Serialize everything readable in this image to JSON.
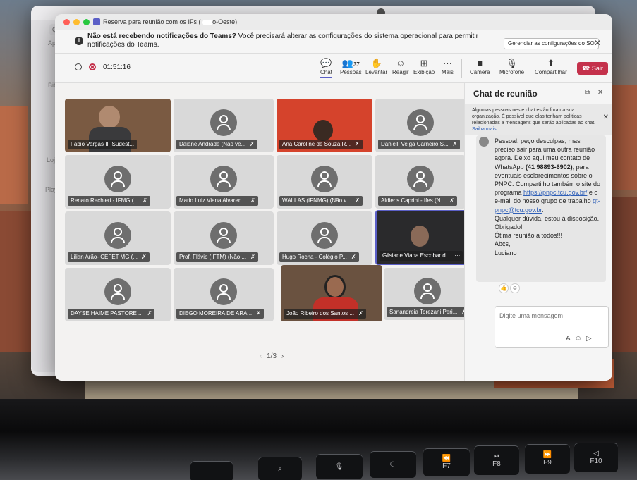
{
  "window": {
    "title": "Reserva para reunião com os IFs (",
    "title_tail": "o-Oeste)"
  },
  "back_app": {
    "search_label": "Q Bi",
    "labels": [
      "Apple",
      "Bibliot",
      "Loja",
      "Playli"
    ]
  },
  "notification": {
    "bold": "Não está recebendo notificações do Teams?",
    "text": " Você precisará alterar as configurações do sistema operacional para permitir notificações do Teams.",
    "button": "Gerenciar as configurações do SO",
    "close": "✕"
  },
  "toolbar": {
    "timer": "01:51:16",
    "people_count": "37",
    "items": [
      {
        "label": "Chat",
        "glyph": "💬"
      },
      {
        "label": "Pessoas",
        "glyph": "👥"
      },
      {
        "label": "Levantar",
        "glyph": "✋"
      },
      {
        "label": "Reagir",
        "glyph": "☺"
      },
      {
        "label": "Exibição",
        "glyph": "⊞"
      },
      {
        "label": "Mais",
        "glyph": "···"
      },
      {
        "label": "Câmera",
        "glyph": "■"
      },
      {
        "label": "Microfone",
        "glyph": "🎙"
      },
      {
        "label": "Compartilhar",
        "glyph": "⬆"
      }
    ],
    "leave": "☎ Sair"
  },
  "participants": [
    {
      "name": "Fabio Vargas IF Sudest...",
      "video": true
    },
    {
      "name": "Daiane Andrade (Não ve...",
      "video": false
    },
    {
      "name": "Ana Caroline de Souza R...",
      "video": true
    },
    {
      "name": "Danielli Veiga Carneiro S...",
      "video": false
    },
    {
      "name": "Renato Rechieri - IFMG (...",
      "video": false
    },
    {
      "name": "Mario Luiz Viana Alvaren...",
      "video": false
    },
    {
      "name": "WALLAS (IFNMG) (Não v...",
      "video": false
    },
    {
      "name": "Aldieris Caprini - Ifes (N...",
      "video": false
    },
    {
      "name": "Lilian Arão- CEFET MG (...",
      "video": false
    },
    {
      "name": "Prof. Flávio (IFTM) (Não ...",
      "video": false
    },
    {
      "name": "Hugo Rocha - Colégio P...",
      "video": false
    },
    {
      "name": "Gilsiane Viana Escobar d...",
      "video": true
    },
    {
      "name": "DAYSE HAIME PASTORE ...",
      "video": false
    },
    {
      "name": "DIEGO MOREIRA DE ARA...",
      "video": false
    },
    {
      "name": "João Ribeiro dos Santos ...",
      "video": true
    },
    {
      "name": "Sanandreia Torezani Peri...",
      "video": false
    }
  ],
  "pagination": {
    "text": "1/3"
  },
  "chat": {
    "title": "Chat de reunião",
    "warning": "Algumas pessoas neste chat estão fora da sua organização. É possível que elas tenham políticas relacionadas a mensagens que serão aplicadas ao chat.",
    "warning_link": "Saiba mais",
    "message": {
      "l1": "Pessoal, peço desculpas, mas preciso sair para uma outra reunião agora. Deixo aqui meu contato de WhatsApp ",
      "phone": "(41 98893-6902)",
      "l2": ", para eventuais esclarecimentos sobre o PNPC. Compartilho também o site do programa ",
      "site": "https://pnpc.tcu.gov.br/",
      "l3": " e o e-mail do nosso grupo de trabalho ",
      "email": "gt-pnpc@tcu.gov.br",
      "l4": ".",
      "l5": "Qualquer dúvida, estou à disposição.",
      "l6": "Obrigado!",
      "l7": "Ótima reunião a todos!!!",
      "l8": "Abçs,",
      "l9": "Luciano"
    },
    "compose_placeholder": "Digite uma mensagem"
  },
  "keyboard": [
    "F7",
    "F8",
    "F9",
    "F10"
  ]
}
